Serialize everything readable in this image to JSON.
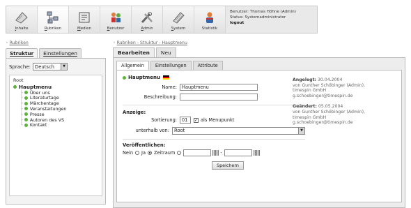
{
  "toolbar": {
    "items": [
      {
        "label": "Inhalte",
        "underline": "I",
        "rest": "nhalte",
        "icon": "content-icon"
      },
      {
        "label": "Rubriken",
        "underline": "R",
        "rest": "ubriken",
        "icon": "rubriken-icon"
      },
      {
        "label": "Medien",
        "underline": "M",
        "rest": "edien",
        "icon": "media-icon"
      },
      {
        "label": "Benutzer",
        "underline": "B",
        "rest": "enutzer",
        "icon": "users-icon"
      },
      {
        "label": "Admin",
        "underline": "A",
        "rest": "dmin",
        "icon": "admin-tools-icon"
      },
      {
        "label": "System",
        "underline": "S",
        "rest": "ystem",
        "icon": "system-icon"
      },
      {
        "label": "Statistik",
        "underline": "",
        "rest": "Statistik",
        "icon": "statistics-icon"
      }
    ],
    "user_line": "Benutzer: Thomas Höhne (Admin)",
    "status_line": "Status: Systemadministrator",
    "logout": "logout"
  },
  "left": {
    "breadcrumb": "Rubriken",
    "tab_structure": "Struktur",
    "tab_settings": "Einstellungen",
    "language_label": "Sprache:",
    "language_value": "Deutsch",
    "tree_root": "Root",
    "tree_main": "Hauptmenu",
    "tree_children": [
      "Über uns",
      "Literaturtage",
      "Märchentage",
      "Veranstaltungen",
      "Presse",
      "Autoren des VS",
      "Kontakt"
    ]
  },
  "right": {
    "breadcrumb": "Rubriken - Struktur - Hauptmenu",
    "tab_edit": "Bearbeiten",
    "tab_new": "Neu",
    "subtab_general": "Allgemein",
    "subtab_settings": "Einstellungen",
    "subtab_attributes": "Attribute",
    "heading": "Hauptmenu",
    "name_label": "Name:",
    "name_value": "Hauptmenu",
    "desc_label": "Beschreibung:",
    "desc_value": "",
    "display_section": "Anzeige:",
    "sort_label": "Sortierung:",
    "sort_value": "01",
    "as_menu_label": "als Menupunkt",
    "below_label": "unterhalb von:",
    "below_value": "Root",
    "publish_section": "Veröffentlichen:",
    "no_label": "Nein",
    "yes_label": "Ja",
    "period_label": "Zeitraum",
    "save_button": "Speichern",
    "created_title": "Angelegt:",
    "created_date": "30.04.2004",
    "created_by": "von Gunther Schöbinger (Admin),",
    "created_company": "timespin GmbH",
    "created_email": "g.schoebinger@timespin.de",
    "changed_title": "Geändert:",
    "changed_date": "05.05.2004",
    "changed_by": "von Gunther Schöbinger (Admin),",
    "changed_company": "timespin GmbH",
    "changed_email": "g.schoebinger@timespin.de"
  }
}
